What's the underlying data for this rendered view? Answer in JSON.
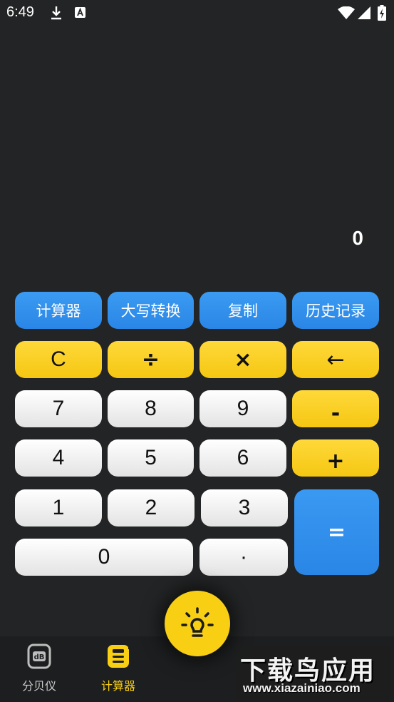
{
  "status_bar": {
    "time": "6:49"
  },
  "display": {
    "value": "0"
  },
  "function_row": [
    "计算器",
    "大写转换",
    "复制",
    "历史记录"
  ],
  "keys": {
    "clear": "C",
    "divide": "÷",
    "multiply": "×",
    "backspace": "←",
    "seven": "7",
    "eight": "8",
    "nine": "9",
    "minus": "-",
    "four": "4",
    "five": "5",
    "six": "6",
    "plus": "+",
    "one": "1",
    "two": "2",
    "three": "3",
    "equals": "=",
    "zero": "0",
    "dot": "·"
  },
  "bottom_nav": {
    "tabs": [
      {
        "label": "分贝仪",
        "icon": "decibel-meter-icon",
        "active": false
      },
      {
        "label": "计算器",
        "icon": "calculator-icon",
        "active": true
      }
    ]
  },
  "watermark": {
    "title": "下载鸟应用",
    "url": "www.xiazainiao.com"
  },
  "colors": {
    "background": "#232425",
    "accent_yellow": "#f8cf12",
    "accent_blue": "#2a86e6"
  }
}
